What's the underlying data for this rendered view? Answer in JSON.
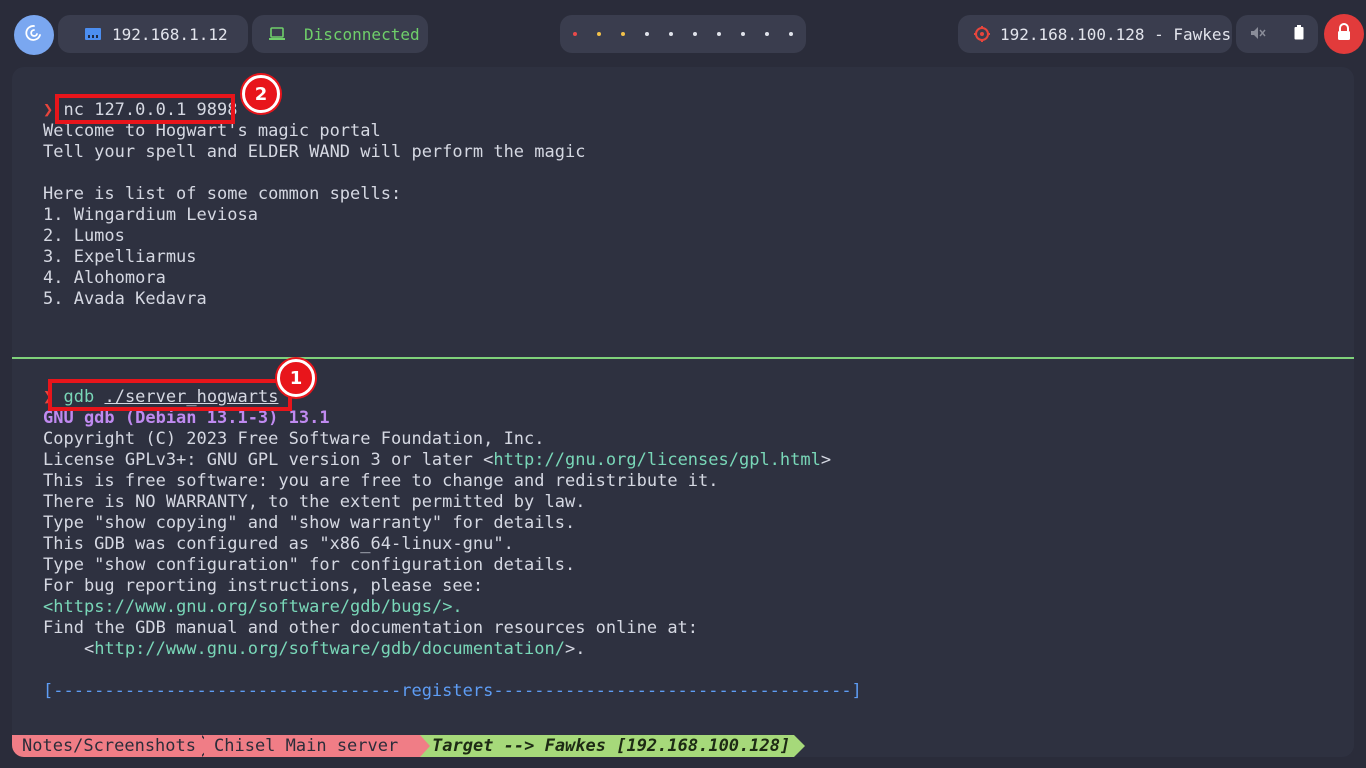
{
  "topbar": {
    "local_ip": "192.168.1.12",
    "vpn_status": "Disconnected",
    "target": "192.168.100.128 - Fawkes",
    "workspace_dot_colors": [
      "#e84a4a",
      "#f2c14a",
      "#f2c14a",
      "#dfe2ea",
      "#dfe2ea",
      "#dfe2ea",
      "#dfe2ea",
      "#dfe2ea",
      "#dfe2ea",
      "#dfe2ea"
    ],
    "icons": {
      "logo": "debian-swirl-icon",
      "ip": "ethernet-icon",
      "vpn": "laptop-icon",
      "target": "crosshair-icon",
      "volume": "volume-muted-icon",
      "battery": "battery-icon",
      "power": "lock-icon"
    },
    "colors": {
      "accent_green": "#7fd17a",
      "alert_red": "#e23b3b"
    }
  },
  "top_pane": {
    "prompt": "❯",
    "command": "nc 127.0.0.1 9898",
    "output": [
      "Welcome to Hogwart's magic portal",
      "Tell your spell and ELDER WAND will perform the magic",
      "",
      "Here is list of some common spells:",
      "1. Wingardium Leviosa",
      "2. Lumos",
      "3. Expelliarmus",
      "4. Alohomora",
      "5. Avada Kedavra"
    ],
    "annotation_badge": "2"
  },
  "bottom_pane": {
    "prompt": "❯",
    "command_name": "gdb",
    "command_arg": "./server_hogwarts",
    "gdb_title": "GNU gdb (Debian 13.1-3) 13.1",
    "lines": {
      "copyright": "Copyright (C) 2023 Free Software Foundation, Inc.",
      "license_prefix": "License GPLv3+: GNU GPL version 3 or later <",
      "license_url": "http://gnu.org/licenses/gpl.html",
      "license_suffix": ">",
      "free_software": "This is free software: you are free to change and redistribute it.",
      "warranty": "There is NO WARRANTY, to the extent permitted by law.",
      "show_copying": "Type \"show copying\" and \"show warranty\" for details.",
      "configured": "This GDB was configured as \"x86_64-linux-gnu\".",
      "show_config": "Type \"show configuration\" for configuration details.",
      "bug_reporting": "For bug reporting instructions, please see:",
      "bugs_prefix": "<",
      "bugs_url": "https://www.gnu.org/software/gdb/bugs/",
      "bugs_suffix": ">.",
      "find_manual": "Find the GDB manual and other documentation resources online at:",
      "doc_prefix": "    <",
      "doc_url": "http://www.gnu.org/software/gdb/documentation/",
      "doc_suffix": ">.",
      "registers": "[----------------------------------registers-----------------------------------]"
    },
    "annotation_badge": "1"
  },
  "statusline": {
    "path": "Notes/Screenshots",
    "session": "Chisel Main server",
    "target": "Target --> Fawkes [192.168.100.128]"
  }
}
